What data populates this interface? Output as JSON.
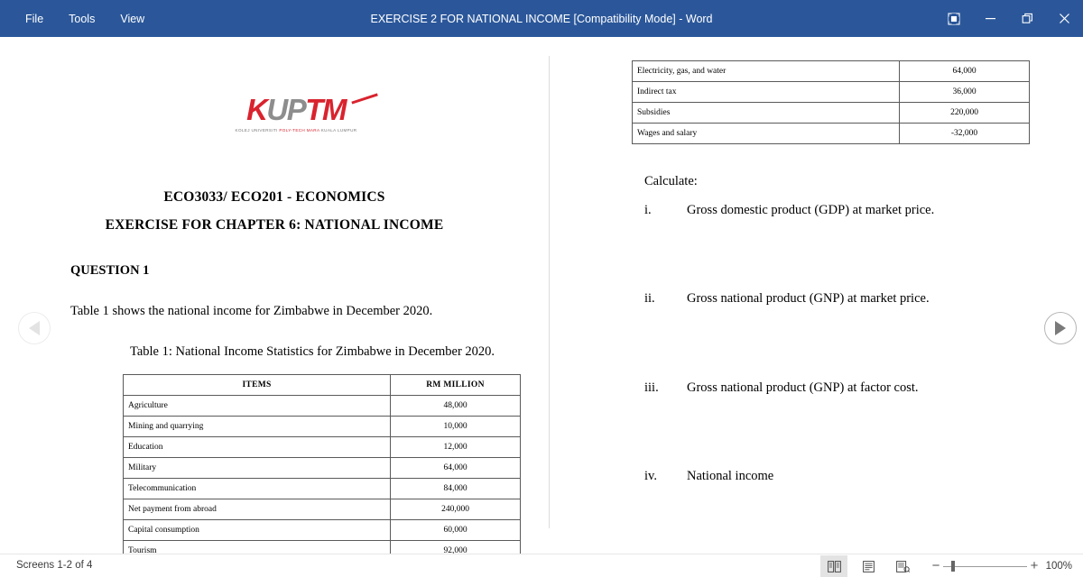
{
  "titlebar": {
    "menus": [
      "File",
      "Tools",
      "View"
    ],
    "document_title": "EXERCISE  2 FOR NATIONAL INCOME [Compatibility Mode]  -  Word",
    "window_buttons": [
      {
        "name": "ribbon-display-options-button",
        "label": "Ribbon Display Options"
      },
      {
        "name": "minimize-button",
        "label": "Minimize"
      },
      {
        "name": "restore-button",
        "label": "Restore Down"
      },
      {
        "name": "close-button",
        "label": "Close"
      }
    ],
    "background_color": "#2b579a"
  },
  "logo": {
    "letters": [
      {
        "char": "K",
        "color": "#d9232e"
      },
      {
        "char": "U",
        "color": "#8d8d8d"
      },
      {
        "char": "P",
        "color": "#8d8d8d"
      },
      {
        "char": "T",
        "color": "#d9232e"
      },
      {
        "char": "M",
        "color": "#d9232e"
      }
    ],
    "tagline_part1": "KOLEJ UNIVERSITI ",
    "tagline_part2": "POLY-TECH MARA",
    "tagline_part3": " KUALA LUMPUR",
    "accent_color": "#d9232e",
    "gray_color": "#8d8d8d"
  },
  "document": {
    "course_heading": "ECO3033/ ECO201 - ECONOMICS",
    "exercise_heading": "EXERCISE FOR CHAPTER 6: NATIONAL INCOME",
    "question_heading": "QUESTION 1",
    "intro_text": "Table 1 shows the national income for Zimbabwe in December 2020.",
    "table_caption": "Table 1: National Income Statistics for Zimbabwe in December 2020.",
    "table": {
      "headers": [
        "ITEMS",
        "RM MILLION"
      ],
      "rows_page1": [
        {
          "item": "Agriculture",
          "value": "48,000"
        },
        {
          "item": "Mining and quarrying",
          "value": "10,000"
        },
        {
          "item": "Education",
          "value": "12,000"
        },
        {
          "item": "Military",
          "value": "64,000"
        },
        {
          "item": "Telecommunication",
          "value": "84,000"
        },
        {
          "item": "Net payment from abroad",
          "value": "240,000"
        },
        {
          "item": "Capital consumption",
          "value": "60,000"
        },
        {
          "item": "Tourism",
          "value": "92,000"
        }
      ],
      "rows_page2": [
        {
          "item": "Electricity, gas, and water",
          "value": "64,000"
        },
        {
          "item": "Indirect tax",
          "value": "36,000"
        },
        {
          "item": "Subsidies",
          "value": "220,000"
        },
        {
          "item": "Wages and salary",
          "value": "-32,000"
        }
      ]
    },
    "calculate_label": "Calculate:",
    "calculate_items": [
      {
        "numeral": "i.",
        "text": "Gross domestic product (GDP) at market price."
      },
      {
        "numeral": "ii.",
        "text": "Gross national product (GNP) at market price."
      },
      {
        "numeral": "iii.",
        "text": "Gross national product (GNP) at factor cost."
      },
      {
        "numeral": "iv.",
        "text": "National income"
      }
    ]
  },
  "navigation": {
    "previous_label": "Previous screen",
    "next_label": "Next screen"
  },
  "statusbar": {
    "screens_text": "Screens 1-2 of 4",
    "view_buttons": [
      {
        "name": "view-mode-two-page",
        "label": "Two page view",
        "active": true
      },
      {
        "name": "view-mode-single-page",
        "label": "Single page view",
        "active": false
      },
      {
        "name": "view-mode-column",
        "label": "Column view",
        "active": false
      }
    ],
    "zoom_out_label": "−",
    "zoom_in_label": "+",
    "zoom_level": "100%"
  }
}
